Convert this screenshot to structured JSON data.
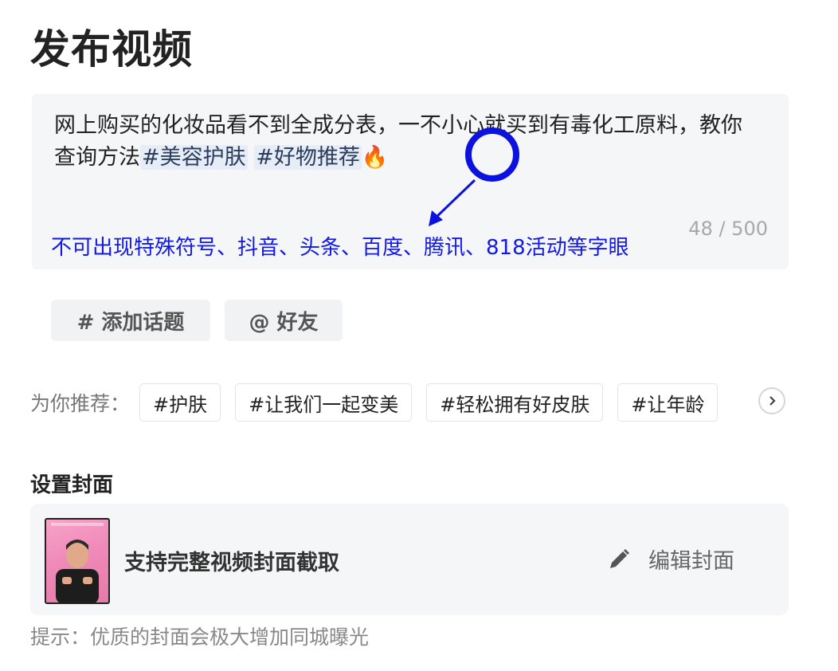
{
  "page_title": "发布视频",
  "description": {
    "text": "网上购买的化妆品看不到全成分表，一不小心就买到有毒化工原料，教你查询方法",
    "tags": [
      "#美容护肤",
      "#好物推荐"
    ],
    "emoji": "🔥",
    "counter": "48 / 500"
  },
  "annotation": {
    "color": "#0b12e0",
    "text": "不可出现特殊符号、抖音、头条、百度、腾讯、818活动等字眼"
  },
  "actions": {
    "add_topic": "# 添加话题",
    "mention_friend": "@ 好友"
  },
  "recommend": {
    "label": "为你推荐：",
    "chips": [
      "#护肤",
      "#让我们一起变美",
      "#轻松拥有好皮肤",
      "#让年龄"
    ],
    "scroll_icon": "chevron-right-icon"
  },
  "cover": {
    "section_title": "设置封面",
    "support_text": "支持完整视频封面截取",
    "edit_label": "编辑封面",
    "edit_icon": "pencil-icon"
  },
  "tip": "提示：优质的封面会极大增加同城曝光"
}
